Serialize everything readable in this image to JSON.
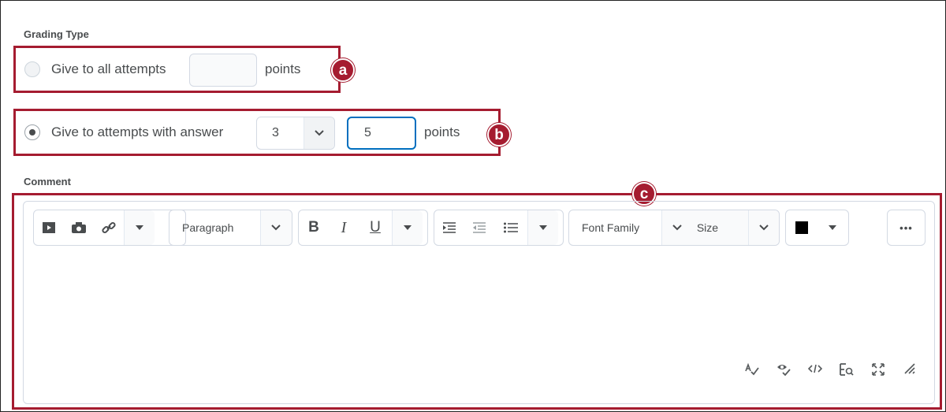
{
  "grading_type": {
    "label": "Grading Type",
    "option_all": {
      "label": "Give to all attempts",
      "value": "",
      "suffix": "points",
      "selected": false
    },
    "option_answer": {
      "label": "Give to attempts with answer",
      "answer_value": "3",
      "points_value": "5",
      "suffix": "points",
      "selected": true
    }
  },
  "comment": {
    "label": "Comment",
    "toolbar": {
      "paragraph": "Paragraph",
      "bold": "B",
      "italic": "I",
      "underline": "U",
      "font_family": "Font Family",
      "size": "Size",
      "more": "•••",
      "color": "#000000"
    }
  },
  "callouts": {
    "a": "a",
    "b": "b",
    "c": "c"
  },
  "accent_color": "#a51c30",
  "focus_color": "#006fbf"
}
